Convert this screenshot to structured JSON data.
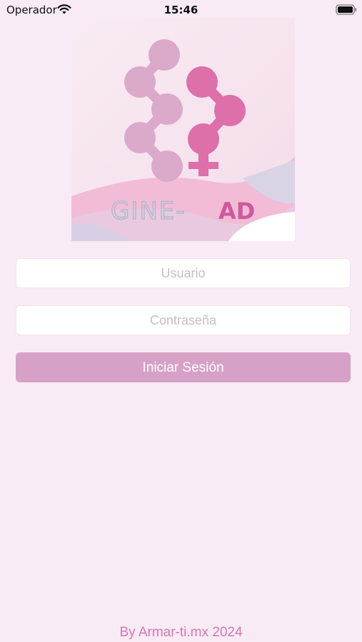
{
  "status_bar": {
    "carrier": "Operador",
    "time": "15:46",
    "icons": [
      "wifi-icon",
      "battery-icon"
    ]
  },
  "logo": {
    "text_primary": "GINE-",
    "text_accent": "AD",
    "colors": {
      "light_pink": "#dba9c9",
      "dark_pink": "#dd6fa9",
      "gray_text": "#b8bacd",
      "accent_text": "#d1589b"
    }
  },
  "login_form": {
    "username_placeholder": "Usuario",
    "password_placeholder": "Contraseña",
    "submit_label": "Iniciar Sesión"
  },
  "footer": {
    "credit": "By Armar-ti.mx 2024"
  },
  "colors": {
    "background": "#f9ebf5",
    "button": "#d7a1c7",
    "footer_text": "#d677ad"
  }
}
